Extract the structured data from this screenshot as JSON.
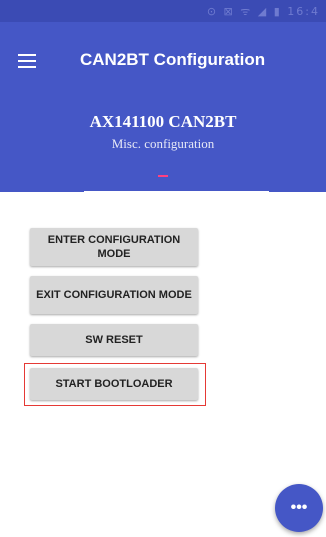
{
  "status_bar": {
    "time": "16:4",
    "icons": "⊙ ⊠ ᯤ ◢ ▮"
  },
  "app_bar": {
    "title": "CAN2BT Configuration",
    "menu_icon": "hamburger-menu-icon"
  },
  "header": {
    "device_title": "AX141100 CAN2BT",
    "subtitle": "Misc. configuration"
  },
  "buttons": {
    "enter_config": "ENTER CONFIGURATION MODE",
    "exit_config": "EXIT CONFIGURATION MODE",
    "sw_reset": "SW RESET",
    "start_bootloader": "START BOOTLOADER"
  },
  "fab": {
    "label": "•••",
    "icon": "more-horizontal-icon"
  },
  "colors": {
    "primary": "#4557c6",
    "status_bar": "#3b4bb4",
    "accent": "#ff4081",
    "highlight": "#e53935",
    "button_bg": "#d8d8d8"
  }
}
